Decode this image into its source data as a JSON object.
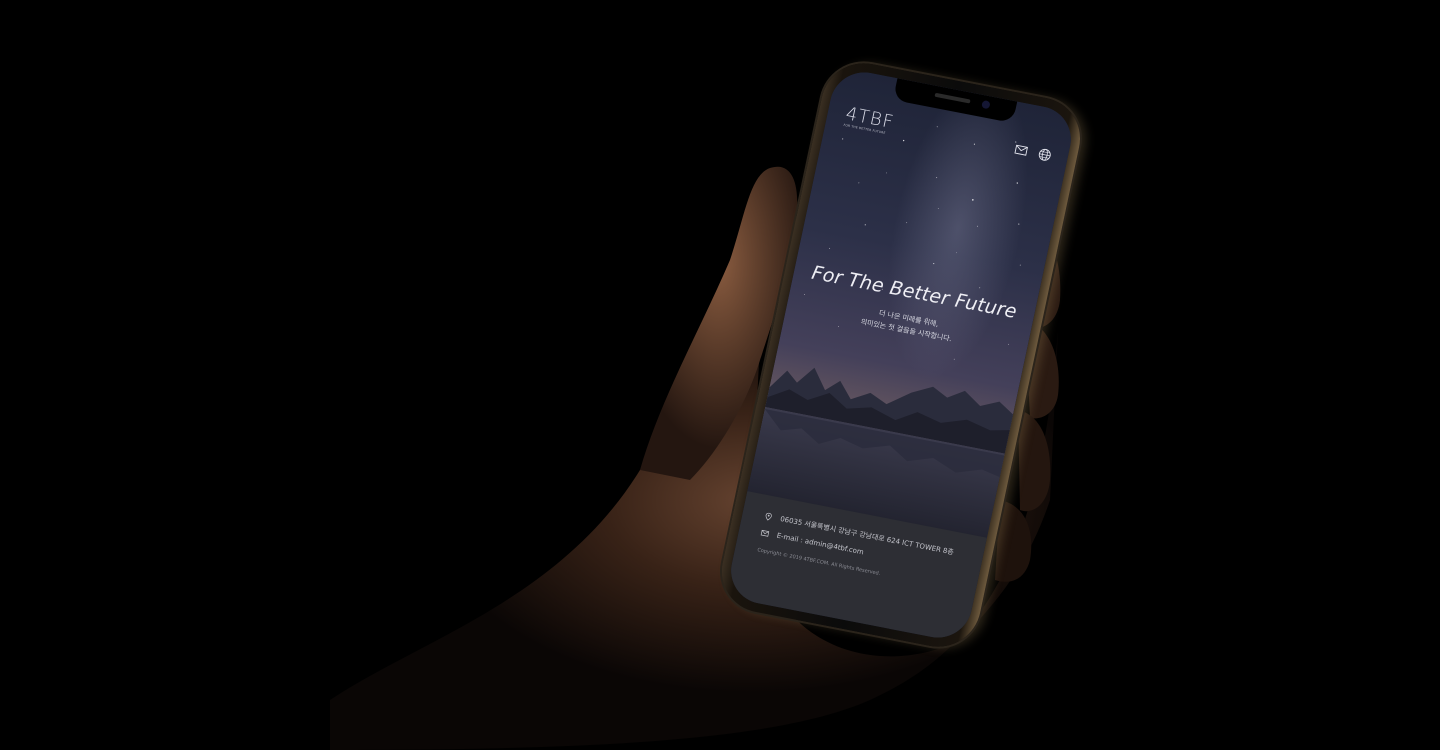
{
  "app": {
    "logo_text": "4TBF",
    "logo_subtext": "FOR THE BETTER FUTURE"
  },
  "header": {
    "mail_icon": "mail-icon",
    "language_icon": "globe-icon"
  },
  "hero": {
    "title": "For The Better Future",
    "subtitle_line1": "더 나은 미래를 위해,",
    "subtitle_line2": "의미있는 첫 걸음을 시작합니다."
  },
  "footer": {
    "address": "06035 서울특별시 강남구 강남대로 624 ICT TOWER 8층",
    "email": "E-mail : admin@4tbf.com",
    "copyright": "Copyright © 2019 4TBF.COM. All Rights Reserved.",
    "address_icon": "location-pin-icon",
    "email_icon": "mail-icon"
  },
  "colors": {
    "background": "#000000",
    "footer_bg": "#2d2e34",
    "text_light": "#eeeef4"
  }
}
